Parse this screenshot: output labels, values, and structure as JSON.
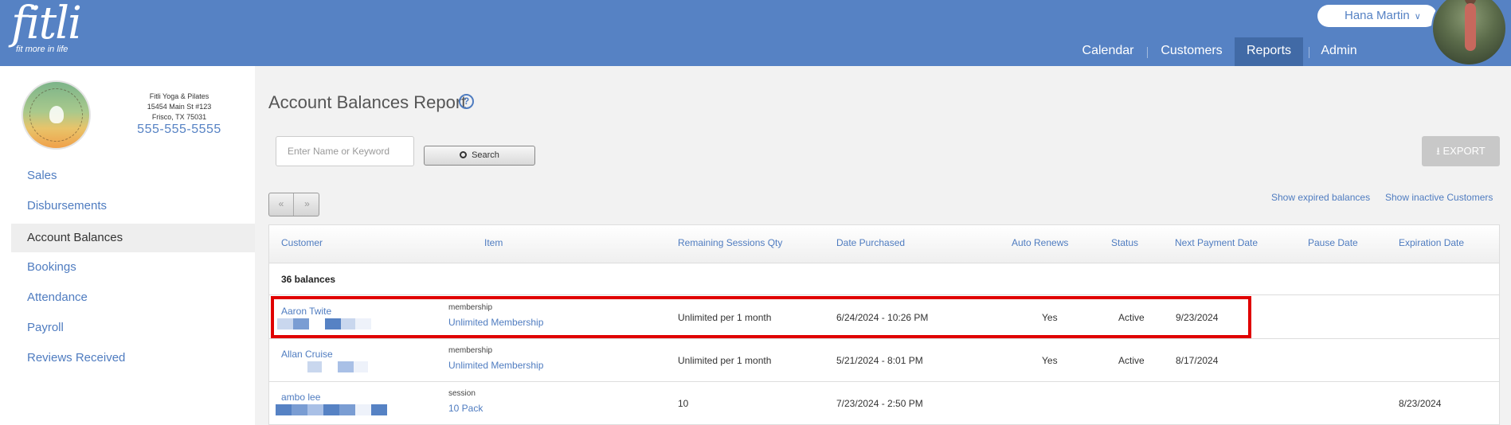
{
  "header": {
    "logo_text": "fitli",
    "logo_tagline": "fit more in life",
    "user_name": "Hana Martin",
    "nav": [
      "Calendar",
      "Customers",
      "Reports",
      "Admin"
    ],
    "active_nav": "Reports"
  },
  "studio": {
    "name": "Fitli Yoga & Pilates",
    "address1": "15454 Main St #123",
    "address2": "Frisco, TX 75031",
    "phone": "555-555-5555"
  },
  "sidebar": {
    "items": [
      {
        "label": "Sales"
      },
      {
        "label": "Disbursements"
      },
      {
        "label": "Account Balances"
      },
      {
        "label": "Bookings"
      },
      {
        "label": "Attendance"
      },
      {
        "label": "Payroll"
      },
      {
        "label": "Reviews Received"
      }
    ],
    "active": "Account Balances"
  },
  "main": {
    "title": "Account Balances Report",
    "help": "?",
    "search_placeholder": "Enter Name or Keyword",
    "search_label": "Search",
    "export_label": "EXPORT",
    "pager_prev": "«",
    "pager_next": "»",
    "show_expired": "Show expired balances",
    "show_inactive": "Show inactive Customers"
  },
  "table": {
    "columns": [
      "Customer",
      "Item",
      "Remaining Sessions Qty",
      "Date Purchased",
      "Auto Renews",
      "Status",
      "Next Payment Date",
      "Pause Date",
      "Expiration Date"
    ],
    "count_label": "36 balances",
    "rows": [
      {
        "customer": "Aaron Twite",
        "item_type": "membership",
        "item_name": "Unlimited Membership",
        "remaining": "Unlimited per 1 month",
        "purchased": "6/24/2024 - 10:26 PM",
        "auto_renews": "Yes",
        "status": "Active",
        "next_payment": "9/23/2024",
        "pause": "",
        "expiration": ""
      },
      {
        "customer": "Allan Cruise",
        "item_type": "membership",
        "item_name": "Unlimited Membership",
        "remaining": "Unlimited per 1 month",
        "purchased": "5/21/2024 - 8:01 PM",
        "auto_renews": "Yes",
        "status": "Active",
        "next_payment": "8/17/2024",
        "pause": "",
        "expiration": ""
      },
      {
        "customer": "ambo lee",
        "item_type": "session",
        "item_name": "10 Pack",
        "remaining": "10",
        "purchased": "7/23/2024 - 2:50 PM",
        "auto_renews": "",
        "status": "",
        "next_payment": "",
        "pause": "",
        "expiration": "8/23/2024"
      }
    ]
  },
  "colors": {
    "header_bg": "#5682c4",
    "active_nav_bg": "#416aa6",
    "link": "#4f7cc0",
    "highlight_border": "#e00000"
  }
}
